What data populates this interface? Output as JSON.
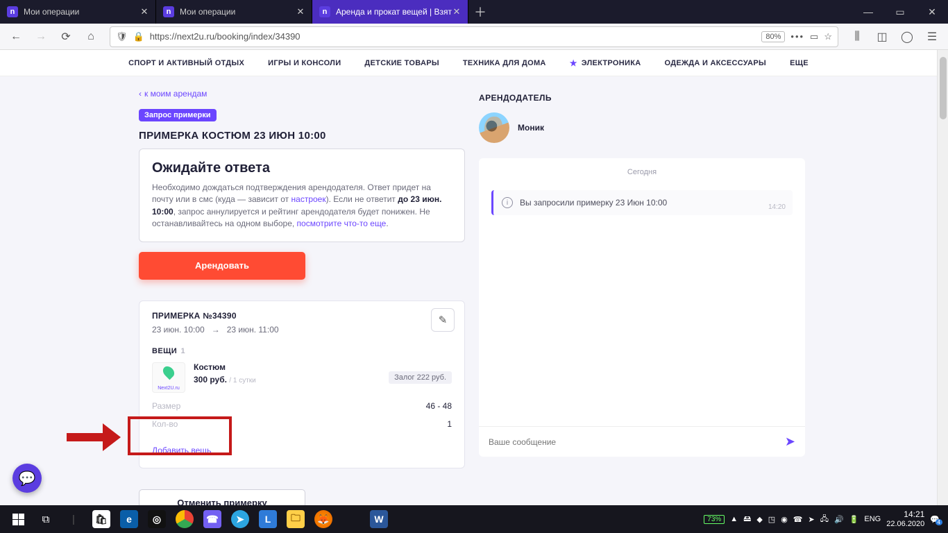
{
  "browser": {
    "tabs": [
      {
        "label": "Мои операции",
        "active": false
      },
      {
        "label": "Мои операции",
        "active": false
      },
      {
        "label": "Аренда и прокат вещей | Взят",
        "active": true
      }
    ],
    "url": "https://next2u.ru/booking/index/34390",
    "zoom": "80%"
  },
  "nav": {
    "items": [
      "СПОРТ И АКТИВНЫЙ ОТДЫХ",
      "ИГРЫ И КОНСОЛИ",
      "ДЕТСКИЕ ТОВАРЫ",
      "ТЕХНИКА ДЛЯ ДОМА",
      "ЭЛЕКТРОНИКА",
      "ОДЕЖДА И АКСЕССУАРЫ",
      "ЕЩЕ"
    ],
    "starred_index": 4
  },
  "booking": {
    "back": "к моим арендам",
    "status_badge": "Запрос примерки",
    "title": "ПРИМЕРКА КОСТЮМ 23 ИЮН 10:00",
    "wait_heading": "Ожидайте ответа",
    "wait_text_1": "Необходимо дождаться подтверждения арендодателя. Ответ придет на почту или в смс (куда — зависит от ",
    "wait_link_1": "настроек",
    "wait_text_2": "). Если не ответит ",
    "wait_bold": "до 23 июн. 10:00",
    "wait_text_3": ", запрос аннулируется и рейтинг арендодателя будет понижен. Не останавливайтесь на одном выборе, ",
    "wait_link_2": "посмотрите что-то еще",
    "wait_text_4": ".",
    "primary_btn": "Арендовать",
    "detail_title": "ПРИМЕРКА №34390",
    "date_from": "23 июн. 10:00",
    "date_to": "23 июн. 11:00",
    "things_heading": "ВЕЩИ",
    "things_count": "1",
    "item_name": "Костюм",
    "item_price": "300 руб.",
    "item_per": "/ 1 сутки",
    "deposit": "Залог 222 руб.",
    "size_label": "Размер",
    "size_value": "46 - 48",
    "qty_label": "Кол-во",
    "qty_value": "1",
    "add_item": "Добавить вещь",
    "cancel_btn": "Отменить примерку"
  },
  "owner": {
    "section": "АРЕНДОДАТЕЛЬ",
    "name": "Моник"
  },
  "chat": {
    "day": "Сегодня",
    "msg": "Вы запросили примерку 23 Июн 10:00",
    "time": "14:20",
    "placeholder": "Ваше сообщение"
  },
  "taskbar": {
    "battery": "73%",
    "lang": "ENG",
    "time": "14:21",
    "date": "22.06.2020",
    "notif": "4"
  }
}
